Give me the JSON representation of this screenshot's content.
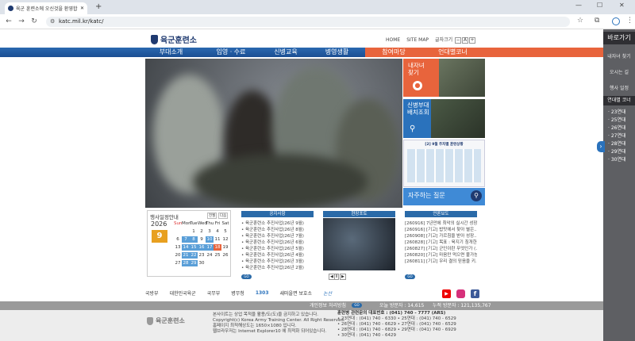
{
  "browser": {
    "tab_title": "육군 훈련소에 오신것을 환영합니다",
    "new_tab": "+",
    "url": "katc.mil.kr/katc/"
  },
  "header": {
    "logo": "육군훈련소",
    "logo_sub": "Korea Army Training Center",
    "home": "HOME",
    "sitemap": "SITE MAP",
    "fontsize_label": "글자크기",
    "zoom_minus": "−",
    "zoom_a": "A",
    "zoom_plus": "+"
  },
  "gnb": [
    "부대소개",
    "입영 · 수료",
    "신병교육",
    "병영생활",
    "참여마당",
    "언대별코너"
  ],
  "promos": {
    "p1": "내자녀\n찾기",
    "p2": "신병부대\n배치조회",
    "p3_title": "[2] 9월 주차별 훈련상황",
    "p4": "자주하는 질문"
  },
  "calendar": {
    "title": "행사일정안내",
    "prev": "전월",
    "next": "다음",
    "year": "2026",
    "month": "9",
    "days_header": [
      "Sun",
      "Mon",
      "Tue",
      "Wed",
      "Thu",
      "Fri",
      "Sat"
    ],
    "weeks": [
      [
        "",
        "",
        "1",
        "2",
        "3",
        "4",
        "5"
      ],
      [
        "6",
        "7",
        "8",
        "9",
        "10",
        "11",
        "12"
      ],
      [
        "13",
        "14",
        "15",
        "16",
        "17",
        "18",
        "19"
      ],
      [
        "20",
        "21",
        "22",
        "23",
        "24",
        "25",
        "26"
      ],
      [
        "27",
        "28",
        "29",
        "30",
        "",
        "",
        ""
      ]
    ]
  },
  "notice": {
    "title": "공지사항",
    "items": [
      "육군훈련소 추진사업(26년 9월)",
      "육군훈련소 추진사업(26년 8월)",
      "육군훈련소 추진사업(26년 7월)",
      "육군훈련소 추진사업(26년 6월)",
      "육군훈련소 추진사업(26년 5월)",
      "육군훈련소 추진사업(26년 4월)",
      "육군훈련소 추진사업(26년 3월)",
      "육군훈련소 추진사업(26년 2월)"
    ],
    "go": "GO"
  },
  "field": {
    "title": "현장포토",
    "prev": "◀",
    "pause": "Ⅱ",
    "next": "▶"
  },
  "press": {
    "title": "언론보도",
    "items": [
      "[260916] 7년만에 최악의 실시간 성장...",
      "[260916] [기고] 밥맛에서 찾아 별은...",
      "[260908] [기고] 가르침을 받아 성장...",
      "[260828] [기고] 목표 : 육지기 침개한...",
      "[260827] [기고] 군인이란 무엇인가 (...",
      "[260820] [기고] 마음만 먹으면 불가능...",
      "[260811] [기고] 우리 결의 믿음을 키..."
    ],
    "go": "GO"
  },
  "partners": [
    "국방부",
    "대한민국육군",
    "국무부",
    "병무청",
    "1303",
    "새마을면 보호소",
    "논산"
  ],
  "footer_bar": {
    "privacy": "개인정보 처리방침",
    "go": "GO",
    "today_label": "오늘 방문자 :",
    "today": "14,615",
    "total_label": "누적 방문자 :",
    "total": "121,135,767"
  },
  "footer": {
    "logo": "육군훈련소",
    "lines": [
      "본사이트는 상업 목적을 활용/도(도)을 금지하고 있습니다.",
      "Copyright(c) Korea Army Training Center. All Right Reserved.",
      "홈페이지 최적해상도는 1650×1080 입니다.",
      "웹브라우저는 Internet Explorer10 에 최적화 되어있습니다."
    ],
    "rep": "훈련병 관련문의 대표번호 : (041) 740 - 7777 (ARS)",
    "phones": [
      "• 23연대 : (041) 740 - 6330  • 25연대 : (041) 740 - 6529",
      "• 26연대 : (041) 740 - 6629  • 27연대 : (041) 740 - 6529",
      "• 28연대 : (041) 740 - 6829  • 29연대 : (041) 740 - 6929",
      "• 30연대 : (041) 740 - 6429"
    ]
  },
  "quick": {
    "title": "바로가기",
    "items": [
      "내자녀 찾기",
      "오시는 길",
      "행사 일정"
    ],
    "section": "연대별 코너",
    "regiments": [
      "· 23연대",
      "· 25연대",
      "· 26연대",
      "· 27연대",
      "· 28연대",
      "· 29연대",
      "· 30연대"
    ],
    "arrow": "›"
  },
  "colors": {
    "navy": "#1f3a70",
    "blue": "#2a72bc",
    "orange": "#e8643c"
  }
}
